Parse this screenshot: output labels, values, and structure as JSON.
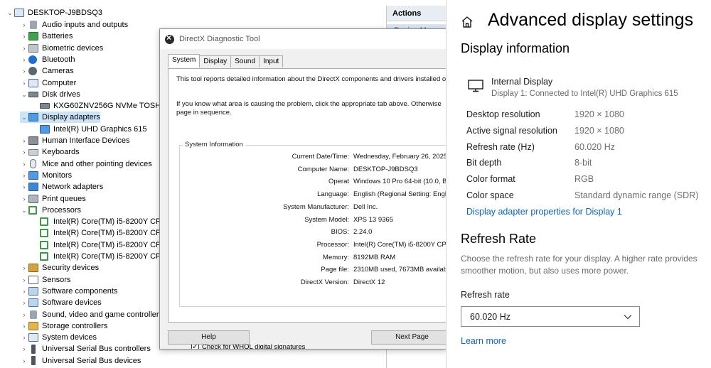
{
  "device_manager": {
    "root": "DESKTOP-J9BDSQ3",
    "items": [
      {
        "label": "Audio inputs and outputs",
        "icon": "speaker-icon",
        "level": 1,
        "expanded": false
      },
      {
        "label": "Batteries",
        "icon": "battery-icon",
        "level": 1,
        "expanded": false
      },
      {
        "label": "Biometric devices",
        "icon": "biometric-icon",
        "level": 1,
        "expanded": false
      },
      {
        "label": "Bluetooth",
        "icon": "bluetooth-icon",
        "level": 1,
        "expanded": false
      },
      {
        "label": "Cameras",
        "icon": "camera-icon",
        "level": 1,
        "expanded": false
      },
      {
        "label": "Computer",
        "icon": "computer-icon",
        "level": 1,
        "expanded": false
      },
      {
        "label": "Disk drives",
        "icon": "disk-icon",
        "level": 1,
        "expanded": true
      },
      {
        "label": "KXG60ZNV256G NVMe TOSHIBA",
        "icon": "disk-icon",
        "level": 2
      },
      {
        "label": "Display adapters",
        "icon": "monitor-icon",
        "level": 1,
        "expanded": true,
        "selected": true
      },
      {
        "label": "Intel(R) UHD Graphics 615",
        "icon": "monitor-icon",
        "level": 2
      },
      {
        "label": "Human Interface Devices",
        "icon": "hid-icon",
        "level": 1,
        "expanded": false
      },
      {
        "label": "Keyboards",
        "icon": "keyboard-icon",
        "level": 1,
        "expanded": false
      },
      {
        "label": "Mice and other pointing devices",
        "icon": "mouse-icon",
        "level": 1,
        "expanded": false
      },
      {
        "label": "Monitors",
        "icon": "monitor-icon",
        "level": 1,
        "expanded": false
      },
      {
        "label": "Network adapters",
        "icon": "network-icon",
        "level": 1,
        "expanded": false
      },
      {
        "label": "Print queues",
        "icon": "printer-icon",
        "level": 1,
        "expanded": false
      },
      {
        "label": "Processors",
        "icon": "chip-icon",
        "level": 1,
        "expanded": true
      },
      {
        "label": "Intel(R) Core(TM) i5-8200Y CPU @",
        "icon": "chip-icon",
        "level": 2
      },
      {
        "label": "Intel(R) Core(TM) i5-8200Y CPU @",
        "icon": "chip-icon",
        "level": 2
      },
      {
        "label": "Intel(R) Core(TM) i5-8200Y CPU @",
        "icon": "chip-icon",
        "level": 2
      },
      {
        "label": "Intel(R) Core(TM) i5-8200Y CPU @",
        "icon": "chip-icon",
        "level": 2
      },
      {
        "label": "Security devices",
        "icon": "security-icon",
        "level": 1,
        "expanded": false
      },
      {
        "label": "Sensors",
        "icon": "sensor-icon",
        "level": 1,
        "expanded": false
      },
      {
        "label": "Software components",
        "icon": "software-icon",
        "level": 1,
        "expanded": false
      },
      {
        "label": "Software devices",
        "icon": "software-icon",
        "level": 1,
        "expanded": false
      },
      {
        "label": "Sound, video and game controllers",
        "icon": "speaker-icon",
        "level": 1,
        "expanded": false
      },
      {
        "label": "Storage controllers",
        "icon": "storage-icon",
        "level": 1,
        "expanded": false
      },
      {
        "label": "System devices",
        "icon": "computer-icon",
        "level": 1,
        "expanded": false
      },
      {
        "label": "Universal Serial Bus controllers",
        "icon": "usb-icon",
        "level": 1,
        "expanded": false
      },
      {
        "label": "Universal Serial Bus devices",
        "icon": "usb-icon",
        "level": 1,
        "expanded": false
      }
    ],
    "actions_header": "Actions",
    "actions_sub": "Device Ma"
  },
  "dxdiag": {
    "title": "DirectX Diagnostic Tool",
    "tabs": [
      "System",
      "Display",
      "Sound",
      "Input"
    ],
    "active_tab": "System",
    "intro": "This tool reports detailed information about the DirectX components and drivers installed o",
    "help_line1": "If you know what area is causing the problem, click the appropriate tab above.  Otherwise",
    "help_line2": "page in sequence.",
    "sysinfo_title": "System Information",
    "fields": [
      {
        "label": "Current Date/Time:",
        "value": "Wednesday, February 26, 2025,"
      },
      {
        "label": "Computer Name:",
        "value": "DESKTOP-J9BDSQ3"
      },
      {
        "label": "Operat",
        "value": "Windows 10 Pro 64-bit (10.0, Bu"
      },
      {
        "label": "Language:",
        "value": "English (Regional Setting: English"
      },
      {
        "label": "System Manufacturer:",
        "value": "Dell Inc."
      },
      {
        "label": "System Model:",
        "value": "XPS 13 9365"
      },
      {
        "label": "BIOS:",
        "value": "2.24.0"
      },
      {
        "label": "Processor:",
        "value": "Intel(R) Core(TM) i5-8200Y CPU"
      },
      {
        "label": "Memory:",
        "value": "8192MB RAM"
      },
      {
        "label": "Page file:",
        "value": "2310MB used, 7673MB available"
      },
      {
        "label": "DirectX Version:",
        "value": "DirectX 12"
      }
    ],
    "whql_label": "Check for WHQL digital signatures",
    "whql_checked": true,
    "help_button": "Help",
    "next_button": "Next Page"
  },
  "settings": {
    "title": "Advanced display settings",
    "display_info_heading": "Display information",
    "display_name": "Internal Display",
    "display_sub": "Display 1: Connected to Intel(R) UHD Graphics 615",
    "rows": [
      {
        "label": "Desktop resolution",
        "value": "1920 × 1080"
      },
      {
        "label": "Active signal resolution",
        "value": "1920 × 1080"
      },
      {
        "label": "Refresh rate (Hz)",
        "value": "60.020 Hz"
      },
      {
        "label": "Bit depth",
        "value": "8-bit"
      },
      {
        "label": "Color format",
        "value": "RGB"
      },
      {
        "label": "Color space",
        "value": "Standard dynamic range (SDR)"
      }
    ],
    "adapter_link": "Display adapter properties for Display 1",
    "refresh_heading": "Refresh Rate",
    "refresh_desc": "Choose the refresh rate for your display. A higher rate provides smoother motion, but also uses more power.",
    "refresh_label": "Refresh rate",
    "refresh_value": "60.020 Hz",
    "learn_more": "Learn more",
    "link_color": "#0a66b8"
  }
}
